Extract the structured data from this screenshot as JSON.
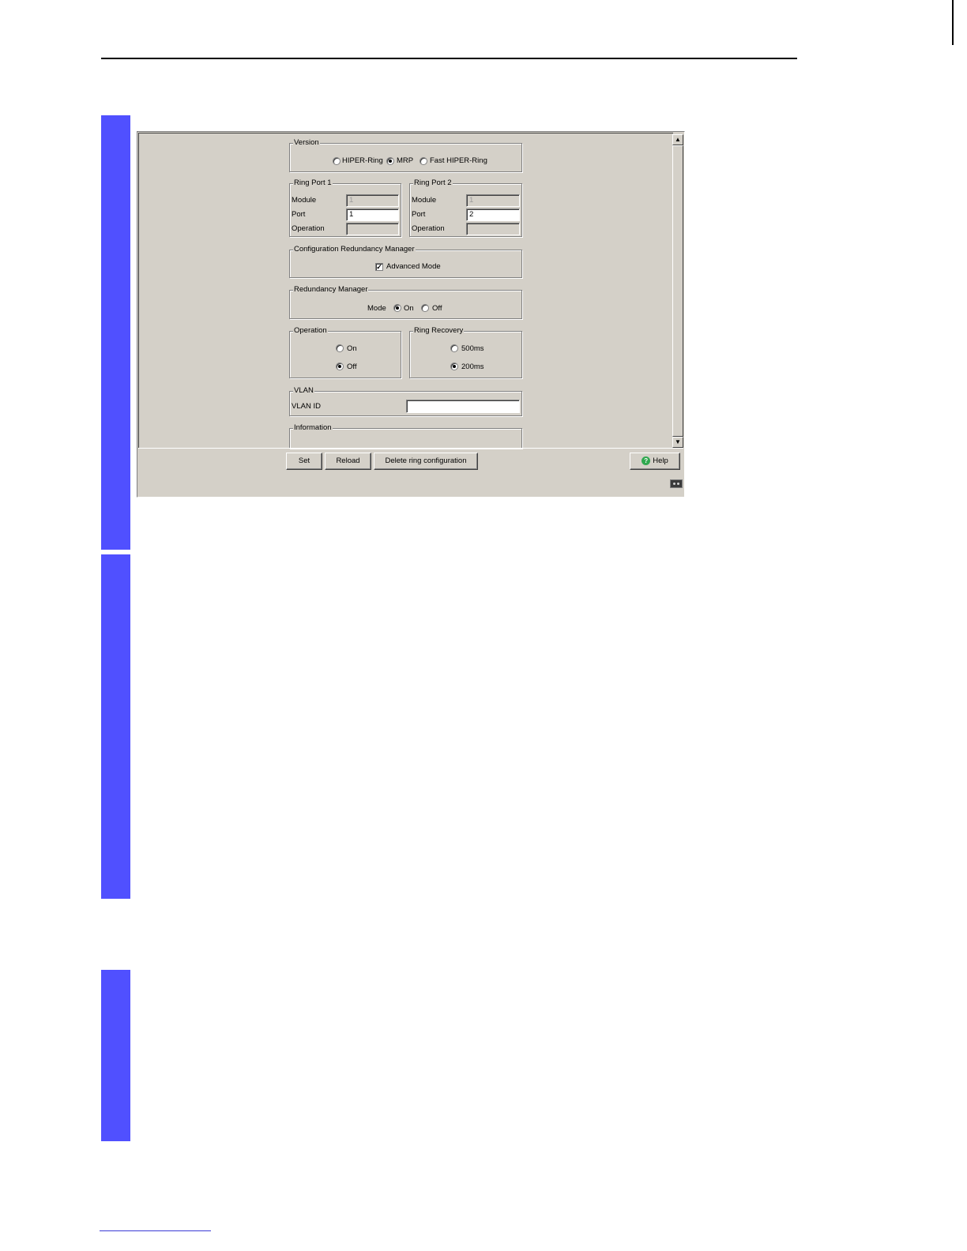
{
  "version": {
    "title": "Version",
    "options": [
      {
        "label": "HIPER-Ring",
        "selected": false
      },
      {
        "label": "MRP",
        "selected": true
      },
      {
        "label": "Fast HIPER-Ring",
        "selected": false
      }
    ]
  },
  "ring_port_1": {
    "title": "Ring Port 1",
    "module_label": "Module",
    "module_value": "1",
    "port_label": "Port",
    "port_value": "1",
    "operation_label": "Operation",
    "operation_value": ""
  },
  "ring_port_2": {
    "title": "Ring Port 2",
    "module_label": "Module",
    "module_value": "1",
    "port_label": "Port",
    "port_value": "2",
    "operation_label": "Operation",
    "operation_value": ""
  },
  "config_rm": {
    "title": "Configuration Redundancy Manager",
    "advanced_mode_label": "Advanced Mode",
    "advanced_mode_checked": true
  },
  "redundancy_manager": {
    "title": "Redundancy Manager",
    "mode_label": "Mode",
    "on_label": "On",
    "off_label": "Off",
    "selected": "On"
  },
  "operation": {
    "title": "Operation",
    "on_label": "On",
    "off_label": "Off",
    "selected": "Off"
  },
  "ring_recovery": {
    "title": "Ring Recovery",
    "opt_500_label": "500ms",
    "opt_200_label": "200ms",
    "selected": "200ms"
  },
  "vlan": {
    "title": "VLAN",
    "id_label": "VLAN ID",
    "id_value": ""
  },
  "information": {
    "title": "Information"
  },
  "buttons": {
    "set": "Set",
    "reload": "Reload",
    "delete_ring": "Delete ring configuration",
    "help": "Help"
  },
  "colors": {
    "dialog_bg": "#d4d0c8",
    "sidebar_accent": "#5050ff"
  }
}
